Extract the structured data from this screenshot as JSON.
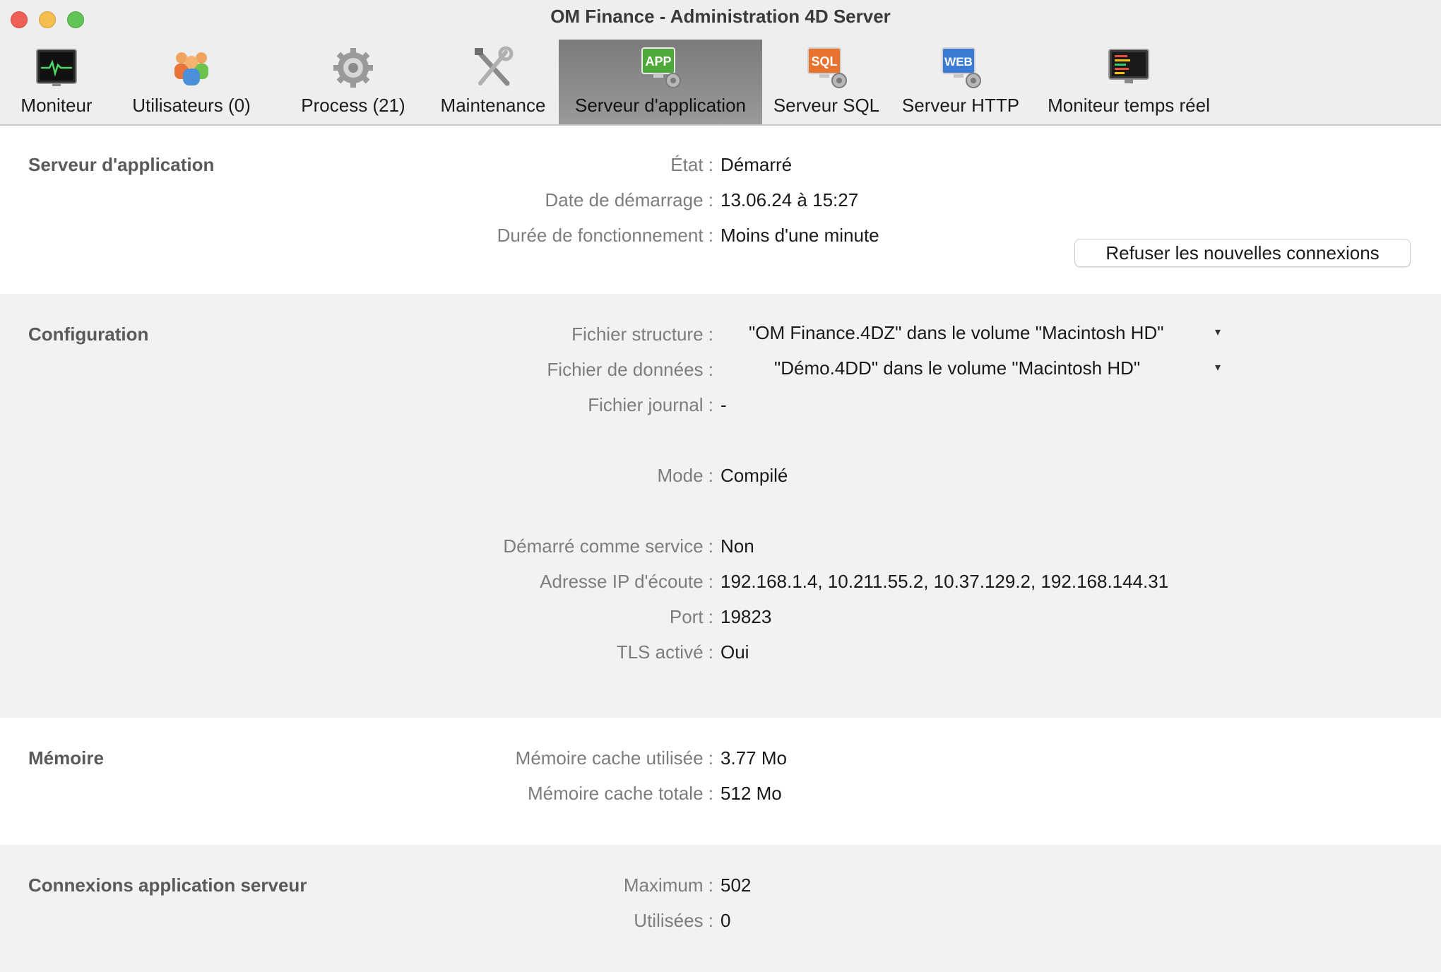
{
  "window": {
    "title": "OM Finance - Administration 4D Server"
  },
  "toolbar": {
    "items": [
      {
        "label": "Moniteur",
        "icon": "monitor-icon"
      },
      {
        "label": "Utilisateurs (0)",
        "icon": "users-icon"
      },
      {
        "label": "Process (21)",
        "icon": "gear-icon"
      },
      {
        "label": "Maintenance",
        "icon": "tools-icon"
      },
      {
        "label": "Serveur d'application",
        "icon": "app-server-icon",
        "icon_text": "APP"
      },
      {
        "label": "Serveur SQL",
        "icon": "sql-server-icon",
        "icon_text": "SQL"
      },
      {
        "label": "Serveur HTTP",
        "icon": "web-server-icon",
        "icon_text": "WEB"
      },
      {
        "label": "Moniteur temps réel",
        "icon": "realtime-monitor-icon"
      }
    ],
    "active_index": 4
  },
  "app_server": {
    "title": "Serveur d'application",
    "etat_label": "État :",
    "etat_value": "Démarré",
    "date_label": "Date de démarrage :",
    "date_value": "13.06.24 à 15:27",
    "duree_label": "Durée de fonctionnement :",
    "duree_value": "Moins d'une minute",
    "refuse_button": "Refuser les nouvelles connexions"
  },
  "configuration": {
    "title": "Configuration",
    "structure_label": "Fichier structure :",
    "structure_value": "\"OM Finance.4DZ\" dans le volume \"Macintosh HD\"",
    "donnees_label": "Fichier de données :",
    "donnees_value": "\"Démo.4DD\" dans le volume \"Macintosh HD\"",
    "journal_label": "Fichier journal :",
    "journal_value": "-",
    "mode_label": "Mode :",
    "mode_value": "Compilé",
    "service_label": "Démarré comme service :",
    "service_value": "Non",
    "ip_label": "Adresse IP d'écoute :",
    "ip_value": "192.168.1.4, 10.211.55.2, 10.37.129.2, 192.168.144.31",
    "port_label": "Port :",
    "port_value": "19823",
    "tls_label": "TLS activé :",
    "tls_value": "Oui"
  },
  "memory": {
    "title": "Mémoire",
    "used_label": "Mémoire cache utilisée :",
    "used_value": "3.77 Mo",
    "total_label": "Mémoire cache totale :",
    "total_value": "512 Mo"
  },
  "connections": {
    "title": "Connexions application serveur",
    "max_label": "Maximum :",
    "max_value": "502",
    "used_label": "Utilisées :",
    "used_value": "0"
  },
  "colors": {
    "toolbar_bg": "#efeeef",
    "active_tab": "#8a8a8a",
    "section_gray": "#f2f2f2"
  }
}
